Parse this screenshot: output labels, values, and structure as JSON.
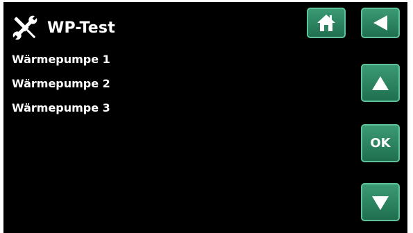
{
  "header": {
    "title": "WP-Test",
    "icon": "tools-icon"
  },
  "menu": {
    "items": [
      {
        "label": "Wärmepumpe 1"
      },
      {
        "label": "Wärmepumpe 2"
      },
      {
        "label": "Wärmepumpe 3"
      }
    ]
  },
  "buttons": {
    "home_icon": "house-icon",
    "back_icon": "arrow-left-icon",
    "up_icon": "arrow-up-icon",
    "ok_label": "OK",
    "down_icon": "arrow-down-icon"
  },
  "colors": {
    "background": "#000000",
    "button": "#2a8560",
    "button_border": "#5ec29a",
    "text": "#ffffff"
  }
}
